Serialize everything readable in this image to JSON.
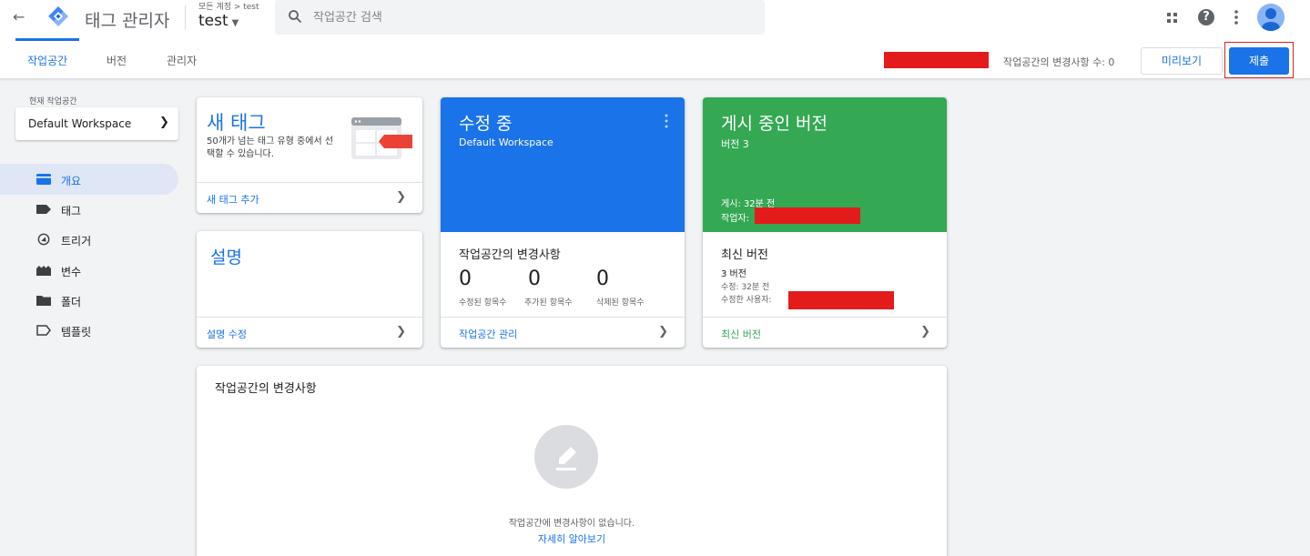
{
  "header": {
    "back_icon": "arrow-back-icon",
    "app_title": "태그 관리자",
    "breadcrumb": "모든 계정 > test",
    "container_name": "test",
    "search_placeholder": "작업공간 검색",
    "icons": [
      "apps-icon",
      "help-icon",
      "more-vert-icon",
      "account-avatar"
    ]
  },
  "tabs": [
    {
      "label": "작업공간",
      "active": true
    },
    {
      "label": "버전",
      "active": false
    },
    {
      "label": "관리자",
      "active": false
    }
  ],
  "toolbar": {
    "changes_count": "작업공간의 변경사항 수: 0",
    "preview_label": "미리보기",
    "submit_label": "제출"
  },
  "sidebar": {
    "current_workspace_label": "현재 작업공간",
    "workspace_name": "Default Workspace",
    "items": [
      {
        "label": "개요",
        "icon": "overview-icon",
        "active": true
      },
      {
        "label": "태그",
        "icon": "tag-icon",
        "active": false
      },
      {
        "label": "트리거",
        "icon": "trigger-icon",
        "active": false
      },
      {
        "label": "변수",
        "icon": "variable-icon",
        "active": false
      },
      {
        "label": "폴더",
        "icon": "folder-icon",
        "active": false
      },
      {
        "label": "템플릿",
        "icon": "template-icon",
        "active": false
      }
    ]
  },
  "new_tag_card": {
    "title": "새 태그",
    "description": "50개가 넘는 태그 유형 중에서 선택할 수 있습니다.",
    "footer": "새 태그 추가"
  },
  "description_card": {
    "title": "설명",
    "footer": "설명 수정"
  },
  "editing_card": {
    "title": "수정 중",
    "workspace": "Default Workspace",
    "changes_title": "작업공간의 변경사항",
    "stats": [
      {
        "value": "0",
        "label": "수정된 항목수"
      },
      {
        "value": "0",
        "label": "추가된 항목수"
      },
      {
        "value": "0",
        "label": "삭제된 항목수"
      }
    ],
    "footer": "작업공간 관리"
  },
  "live_card": {
    "title": "게시 중인 버전",
    "version": "버전 3",
    "published": "게시: 32분 전",
    "author_label": "작업자:",
    "latest_title": "최신 버전",
    "latest_version": "3 버전",
    "latest_modified": "수정: 32분 전",
    "latest_modified_by": "수정한 사용자:",
    "footer": "최신 버전"
  },
  "workspace_changes_card": {
    "title": "작업공간의 변경사항",
    "empty_icon": "edit-pencil-icon",
    "empty_text": "작업공간에 변경사항이 없습니다.",
    "learn_more": "자세히 알아보기"
  },
  "colors": {
    "primary": "#1a73e8",
    "green": "#34a853",
    "redaction": "#e31b1b"
  }
}
